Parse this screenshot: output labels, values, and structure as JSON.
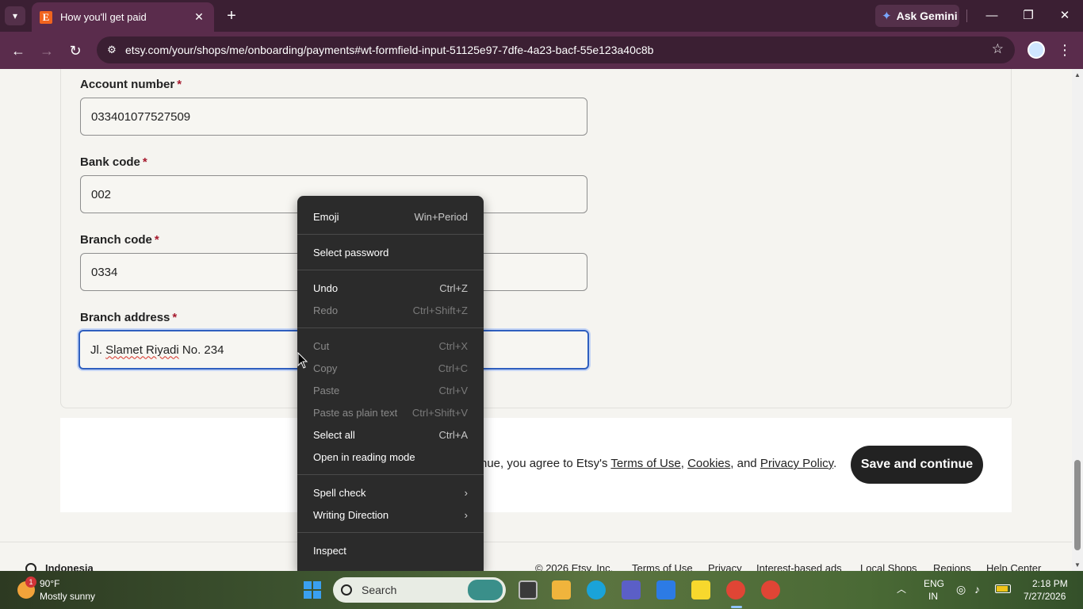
{
  "browser": {
    "tab_title": "How you'll get paid",
    "tab_favicon_letter": "E",
    "new_tab_glyph": "+",
    "url": "etsy.com/your/shops/me/onboarding/payments#wt-formfield-input-51125e97-7dfe-4a23-bacf-55e123a40c8b",
    "gemini_label": "Ask Gemini"
  },
  "form": {
    "fields": [
      {
        "label": "Account number",
        "value": "033401077527509"
      },
      {
        "label": "Bank code",
        "value": "002"
      },
      {
        "label": "Branch code",
        "value": "0334"
      },
      {
        "label": "Branch address",
        "value_prefix": "Jl.",
        "value_mid": "Slamet Riyadi",
        "value_suffix": "No. 234"
      }
    ],
    "required_marker": "*"
  },
  "footer": {
    "legal_prefix": "nue, you agree to Etsy's",
    "terms_link": "Terms of Use",
    "cookies_link": "Cookies",
    "and_text": ", and",
    "privacy_link": "Privacy Policy",
    "save_label": "Save and continue"
  },
  "site_footer": {
    "region": "Indonesia",
    "copyright": "© 2026 Etsy, Inc.",
    "links": [
      "Terms of Use",
      "Privacy",
      "Interest-based ads",
      "Local Shops",
      "Regions",
      "Help Center"
    ]
  },
  "context_menu": {
    "items": [
      {
        "label": "Emoji",
        "shortcut": "Win+Period",
        "enabled": true
      },
      {
        "label": "Select password",
        "shortcut": "",
        "enabled": true
      },
      {
        "label": "Undo",
        "shortcut": "Ctrl+Z",
        "enabled": true
      },
      {
        "label": "Redo",
        "shortcut": "Ctrl+Shift+Z",
        "enabled": false
      },
      {
        "label": "Cut",
        "shortcut": "Ctrl+X",
        "enabled": false
      },
      {
        "label": "Copy",
        "shortcut": "Ctrl+C",
        "enabled": false
      },
      {
        "label": "Paste",
        "shortcut": "Ctrl+V",
        "enabled": false
      },
      {
        "label": "Paste as plain text",
        "shortcut": "Ctrl+Shift+V",
        "enabled": false
      },
      {
        "label": "Select all",
        "shortcut": "Ctrl+A",
        "enabled": true
      },
      {
        "label": "Open in reading mode",
        "shortcut": "",
        "enabled": true
      },
      {
        "label": "Spell check",
        "shortcut": "›",
        "enabled": true
      },
      {
        "label": "Writing Direction",
        "shortcut": "›",
        "enabled": true
      },
      {
        "label": "Inspect",
        "shortcut": "",
        "enabled": true
      }
    ]
  },
  "taskbar": {
    "weather_temp": "90°F",
    "weather_desc": "Mostly sunny",
    "weather_badge": "1",
    "search_placeholder": "Search",
    "lang_line1": "ENG",
    "lang_line2": "IN",
    "time": "2:18 PM",
    "date": "7/27/2026"
  },
  "colors": {
    "accent_required": "#a61a2e",
    "primary_button": "#222222",
    "focus_ring": "#2f5fbf",
    "chrome_dark": "#3b1f33",
    "chrome_mid": "#5a2c4c"
  }
}
